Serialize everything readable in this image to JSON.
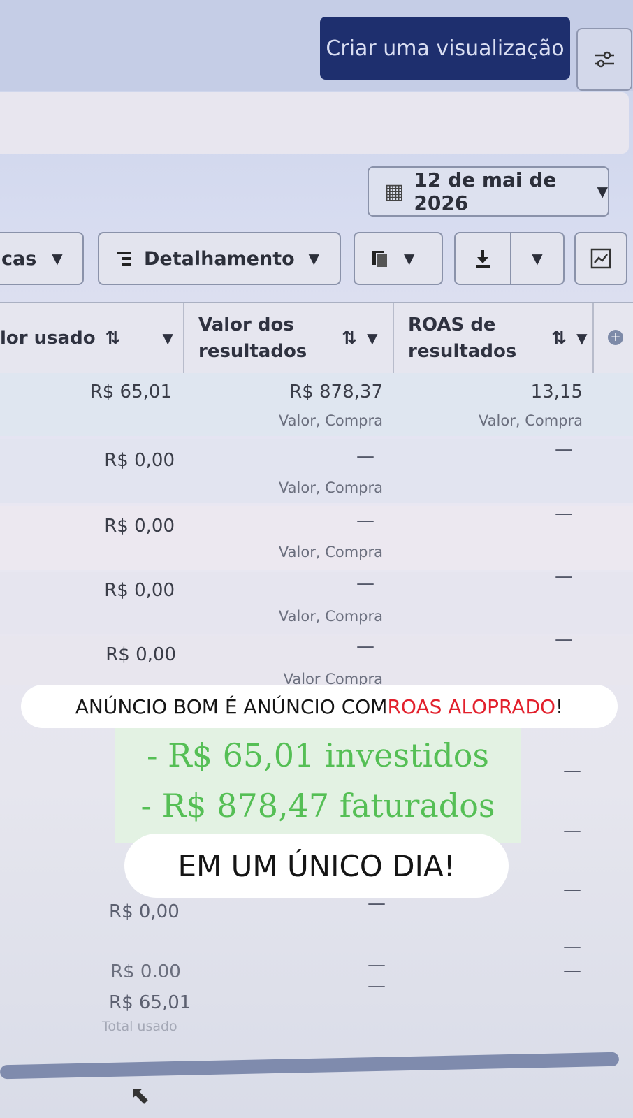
{
  "header": {
    "create_button": "Criar uma visualização",
    "settings_icon": "sliders-icon"
  },
  "date_picker": {
    "value": "12 de mai de 2026",
    "icon": "calendar-icon"
  },
  "toolbar": {
    "partial_label": "cas",
    "breakdown_label": "Detalhamento",
    "breakdown_icon": "breakdown-icon",
    "report_icon": "report-icon",
    "download_icon": "download-icon",
    "chart_icon": "chart-icon"
  },
  "columns": {
    "col1": "lor usado",
    "col2_line1": "Valor dos",
    "col2_line2": "resultados",
    "col3_line1": "ROAS de",
    "col3_line2": "resultados",
    "sort_glyph": "⇅"
  },
  "rows": [
    {
      "spent": "R$ 65,01",
      "value": "R$ 878,37",
      "value_sub": "Valor, Compra",
      "roas": "13,15",
      "roas_sub": "Valor, Compra"
    },
    {
      "spent": "R$ 0,00",
      "value": "—",
      "value_sub": "Valor, Compra",
      "roas": "—"
    },
    {
      "spent": "R$ 0,00",
      "value": "—",
      "value_sub": "Valor, Compra",
      "roas": "—"
    },
    {
      "spent": "R$ 0,00",
      "value": "—",
      "value_sub": "Valor, Compra",
      "roas": "—"
    },
    {
      "spent": "R$ 0,00",
      "value": "—",
      "value_sub": "Valor Compra",
      "roas": "—"
    }
  ],
  "lower_rows": {
    "r1_spent": "R$ 0,00",
    "r2_spent": "R$ 0,00",
    "dash": "—"
  },
  "total": {
    "value": "R$ 65,01",
    "label": "Total usado"
  },
  "overlay": {
    "banner_prefix": "ANÚNCIO BOM É ANÚNCIO COM ",
    "banner_highlight": "ROAS ALOPRADO",
    "banner_suffix": "!",
    "line1": "- R$ 65,01 investidos",
    "line2": "- R$ 878,47 faturados",
    "bottom": "EM UM ÚNICO DIA!"
  },
  "colors": {
    "accent": "#1e2f6e",
    "highlight_red": "#e2202c",
    "green_text": "#55bf55"
  }
}
